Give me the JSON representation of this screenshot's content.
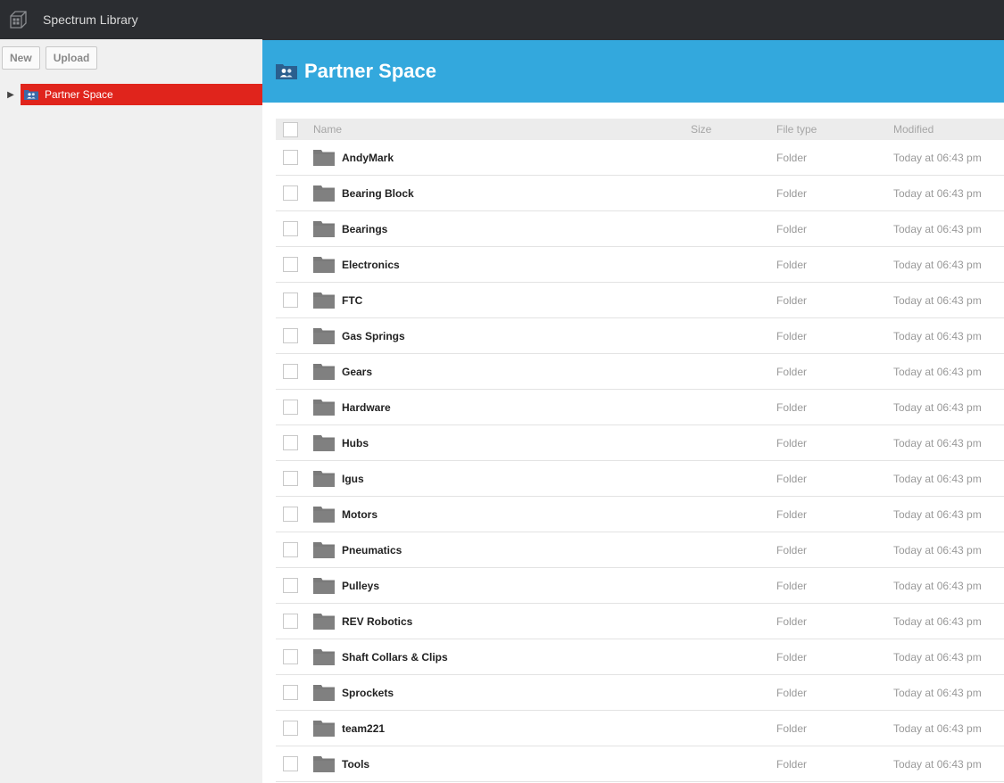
{
  "app": {
    "title": "Spectrum Library"
  },
  "toolbar": {
    "new_label": "New",
    "upload_label": "Upload"
  },
  "tree": {
    "expand_glyph": "▶",
    "node_label": "Partner Space",
    "node_icon": "people-folder-icon"
  },
  "page": {
    "title": "Partner Space"
  },
  "colors": {
    "accent": "#33a8dd",
    "selected": "#e0241c",
    "header_bg": "#2b2d31"
  },
  "table": {
    "columns": {
      "name": "Name",
      "size": "Size",
      "type": "File type",
      "modified": "Modified"
    },
    "rows": [
      {
        "name": "AndyMark",
        "size": "",
        "type": "Folder",
        "modified": "Today at 06:43 pm"
      },
      {
        "name": "Bearing Block",
        "size": "",
        "type": "Folder",
        "modified": "Today at 06:43 pm"
      },
      {
        "name": "Bearings",
        "size": "",
        "type": "Folder",
        "modified": "Today at 06:43 pm"
      },
      {
        "name": "Electronics",
        "size": "",
        "type": "Folder",
        "modified": "Today at 06:43 pm"
      },
      {
        "name": "FTC",
        "size": "",
        "type": "Folder",
        "modified": "Today at 06:43 pm"
      },
      {
        "name": "Gas Springs",
        "size": "",
        "type": "Folder",
        "modified": "Today at 06:43 pm"
      },
      {
        "name": "Gears",
        "size": "",
        "type": "Folder",
        "modified": "Today at 06:43 pm"
      },
      {
        "name": "Hardware",
        "size": "",
        "type": "Folder",
        "modified": "Today at 06:43 pm"
      },
      {
        "name": "Hubs",
        "size": "",
        "type": "Folder",
        "modified": "Today at 06:43 pm"
      },
      {
        "name": "Igus",
        "size": "",
        "type": "Folder",
        "modified": "Today at 06:43 pm"
      },
      {
        "name": "Motors",
        "size": "",
        "type": "Folder",
        "modified": "Today at 06:43 pm"
      },
      {
        "name": "Pneumatics",
        "size": "",
        "type": "Folder",
        "modified": "Today at 06:43 pm"
      },
      {
        "name": "Pulleys",
        "size": "",
        "type": "Folder",
        "modified": "Today at 06:43 pm"
      },
      {
        "name": "REV Robotics",
        "size": "",
        "type": "Folder",
        "modified": "Today at 06:43 pm"
      },
      {
        "name": "Shaft Collars & Clips",
        "size": "",
        "type": "Folder",
        "modified": "Today at 06:43 pm"
      },
      {
        "name": "Sprockets",
        "size": "",
        "type": "Folder",
        "modified": "Today at 06:43 pm"
      },
      {
        "name": "team221",
        "size": "",
        "type": "Folder",
        "modified": "Today at 06:43 pm"
      },
      {
        "name": "Tools",
        "size": "",
        "type": "Folder",
        "modified": "Today at 06:43 pm"
      }
    ]
  }
}
